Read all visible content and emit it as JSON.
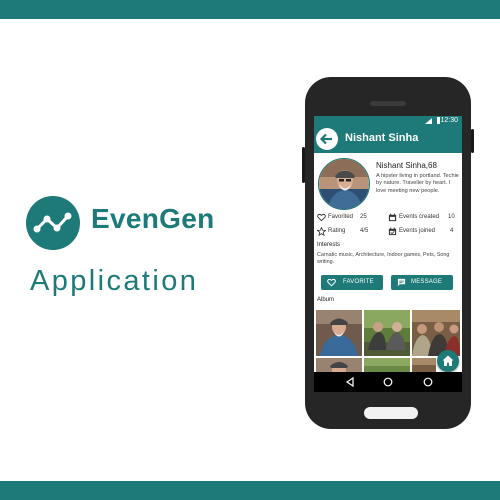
{
  "brand": {
    "name": "EvenGen",
    "subtitle": "Application",
    "logo_icon": "trend-line-icon",
    "accent_color": "#1d7a78"
  },
  "status_bar": {
    "time": "12:30"
  },
  "app_bar": {
    "title": "Nishant Sinha",
    "back_icon": "arrow-left-icon"
  },
  "profile": {
    "name_age": "Nishant Sinha,68",
    "bio": "A hipster living in portland. Techie by nature. Traveller by heart. I love meeting new people."
  },
  "stats": [
    {
      "label": "Favorited",
      "value": "25",
      "icon": "heart-outline-icon"
    },
    {
      "label": "Events created",
      "value": "10",
      "icon": "calendar-icon"
    },
    {
      "label": "Rating",
      "value": "4/5",
      "icon": "star-outline-icon"
    },
    {
      "label": "Events joined",
      "value": "4",
      "icon": "calendar-check-icon"
    }
  ],
  "interests": {
    "label": "Interests",
    "text": "Carnatic music, Architecture, Indoor games, Pets, Song writing."
  },
  "actions": {
    "favorite_label": "FAVORITE",
    "message_label": "MESSAGE"
  },
  "album": {
    "label": "Album"
  },
  "fab_icon": "home-icon",
  "nav_icons": [
    "back-triangle-icon",
    "home-circle-icon",
    "recents-circle-icon"
  ]
}
